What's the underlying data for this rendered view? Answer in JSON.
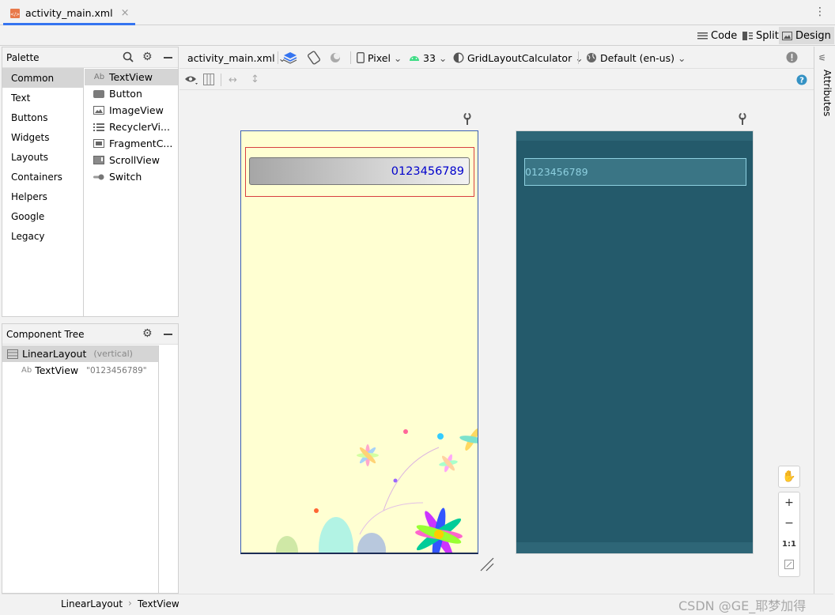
{
  "tab": {
    "file_name": "activity_main.xml",
    "close": "×"
  },
  "modes": {
    "code": "Code",
    "split": "Split",
    "design": "Design"
  },
  "palette": {
    "title": "Palette",
    "categories": [
      "Common",
      "Text",
      "Buttons",
      "Widgets",
      "Layouts",
      "Containers",
      "Helpers",
      "Google",
      "Legacy"
    ],
    "items": [
      {
        "label": "TextView",
        "icon": "textview-icon"
      },
      {
        "label": "Button",
        "icon": "button-icon"
      },
      {
        "label": "ImageView",
        "icon": "imageview-icon"
      },
      {
        "label": "RecyclerVi...",
        "icon": "recyclerview-icon"
      },
      {
        "label": "FragmentC...",
        "icon": "fragment-icon"
      },
      {
        "label": "ScrollView",
        "icon": "scrollview-icon"
      },
      {
        "label": "Switch",
        "icon": "switch-icon"
      }
    ]
  },
  "component_tree": {
    "title": "Component Tree",
    "root": {
      "label": "LinearLayout",
      "detail": "(vertical)"
    },
    "child": {
      "icon_text": "Ab",
      "label": "TextView",
      "detail": "\"0123456789\""
    }
  },
  "toolbar": {
    "file": "activity_main.xml",
    "device": "Pixel",
    "api": "33",
    "theme": "GridLayoutCalculator",
    "locale": "Default (en-us)"
  },
  "preview": {
    "text_value": "0123456789"
  },
  "attributes_label": "Attributes",
  "breadcrumb": [
    "LinearLayout",
    "TextView"
  ],
  "zoom": {
    "fit": "1:1"
  },
  "watermark": "CSDN @GE_耶梦加得",
  "colors": {
    "accent": "#3574f0",
    "textview_text": "#0000cc",
    "blueprint_bg": "#245a6b"
  }
}
